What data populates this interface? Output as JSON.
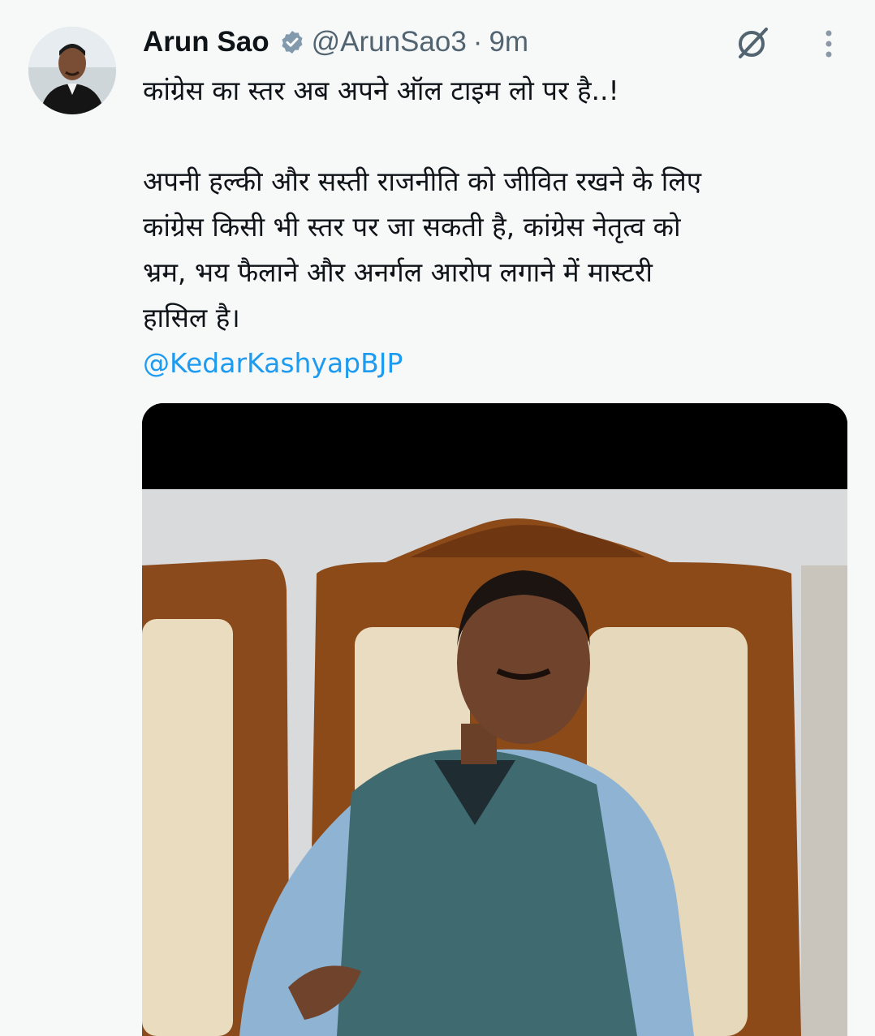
{
  "author": {
    "display_name": "Arun Sao",
    "handle": "@ArunSao3",
    "separator": "·",
    "time": "9m",
    "verified": true,
    "avatar_icon": "profile-photo"
  },
  "tweet": {
    "line1": "कांग्रेस का स्तर अब अपने ऑल टाइम लो पर है..!",
    "para2_line1": "अपनी हल्की और सस्ती राजनीति को जीवित रखने के लिए",
    "para2_line2": "कांग्रेस किसी भी स्तर पर जा सकती है, कांग्रेस नेतृत्व को",
    "para2_line3": "भ्रम, भय फैलाने और अनर्गल आरोप लगाने में मास्टरी",
    "para2_line4": "हासिल है।",
    "mention": "@KedarKashyapBJP"
  },
  "icons": {
    "grok": "grok-icon",
    "more": "more-icon",
    "verified": "verified-badge-icon"
  },
  "colors": {
    "background": "#f7f9f9",
    "text": "#0f1419",
    "secondary": "#536471",
    "link": "#1d9bf0"
  }
}
